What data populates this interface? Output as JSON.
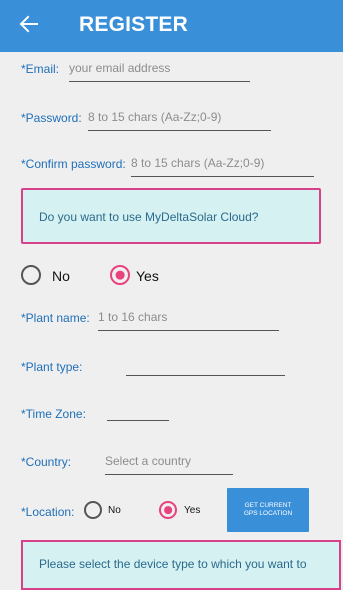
{
  "appbar": {
    "title": "REGISTER",
    "back_icon": "arrow-left-icon"
  },
  "fields": {
    "email": {
      "label": "*Email:",
      "placeholder": "your email address"
    },
    "password": {
      "label": "*Password:",
      "placeholder": "8 to 15 chars (Aa-Zz;0-9)"
    },
    "confirm": {
      "label": "*Confirm password:",
      "placeholder": "8 to 15 chars (Aa-Zz;0-9)"
    },
    "plant_name": {
      "label": "*Plant name:",
      "placeholder": "1 to 16 chars"
    },
    "plant_type": {
      "label": "*Plant type:",
      "value": ""
    },
    "time_zone": {
      "label": "*Time Zone:",
      "value": ""
    },
    "country": {
      "label": "*Country:",
      "placeholder": "Select a country"
    },
    "location": {
      "label": "*Location:"
    }
  },
  "cloud": {
    "question": "Do you want to use MyDeltaSolar Cloud?",
    "no_label": "No",
    "yes_label": "Yes",
    "selected": "Yes"
  },
  "location_options": {
    "no_label": "No",
    "yes_label": "Yes",
    "selected": "Yes"
  },
  "gps_button": {
    "line1": "GET CURRENT",
    "line2": "GPS LOCATION"
  },
  "device_prompt": "Please select the device type to which you want to",
  "colors": {
    "accent": "#3a8fd9",
    "radio_selected": "#e8437f",
    "box_border": "#d7418a",
    "box_bg": "#d6f1f2",
    "label": "#1f6fb8"
  }
}
